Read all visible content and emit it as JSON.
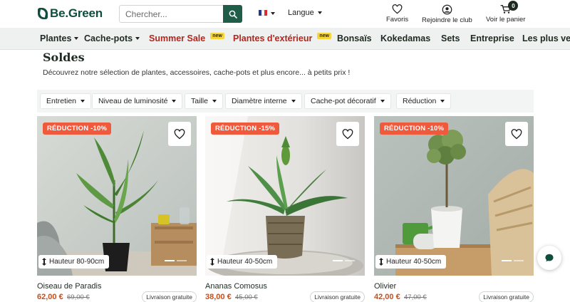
{
  "brand": {
    "name": "Be.Green"
  },
  "search": {
    "placeholder": "Chercher..."
  },
  "language": {
    "label": "Langue"
  },
  "header_links": {
    "favorites": "Favoris",
    "club": "Rejoindre le club",
    "cart": "Voir le panier",
    "cart_count": "0"
  },
  "nav": {
    "items": [
      {
        "label": "Plantes"
      },
      {
        "label": "Cache-pots"
      },
      {
        "label": "Summer Sale",
        "badge": "new"
      },
      {
        "label": "Plantes d'extérieur",
        "badge": "new"
      },
      {
        "label": "Bonsaïs"
      },
      {
        "label": "Kokedamas"
      },
      {
        "label": "Sets"
      },
      {
        "label": "Entreprise"
      },
      {
        "label": "Les plus ven"
      }
    ]
  },
  "page": {
    "title": "Soldes",
    "description": "Découvrez notre sélection de plantes, accessoires, cache-pots et plus encore... à petits prix !"
  },
  "filters": [
    {
      "label": "Entretien"
    },
    {
      "label": "Niveau de luminosité"
    },
    {
      "label": "Taille"
    },
    {
      "label": "Diamètre interne"
    },
    {
      "label": "Cache-pot décoratif"
    },
    {
      "label": "Réduction"
    }
  ],
  "products": [
    {
      "name": "Oiseau de Paradis",
      "discount": "RÉDUCTION -10%",
      "height": "Hauteur 80-90cm",
      "price": "62,00 €",
      "old_price": "69,00 €",
      "shipping": "Livraison gratuite"
    },
    {
      "name": "Ananas Comosus",
      "discount": "RÉDUCTION -15%",
      "height": "Hauteur 40-50cm",
      "price": "38,00 €",
      "old_price": "45,00 €",
      "shipping": "Livraison gratuite"
    },
    {
      "name": "Olivier",
      "discount": "RÉDUCTION -10%",
      "height": "Hauteur 40-50cm",
      "price": "42,00 €",
      "old_price": "47,00 €",
      "shipping": "Livraison gratuite"
    }
  ],
  "colors": {
    "brand_green": "#0d4f3c",
    "sale_red": "#b3261e",
    "discount_badge": "#f05a3c",
    "price_orange": "#c94e18",
    "new_badge": "#f6d53b"
  }
}
